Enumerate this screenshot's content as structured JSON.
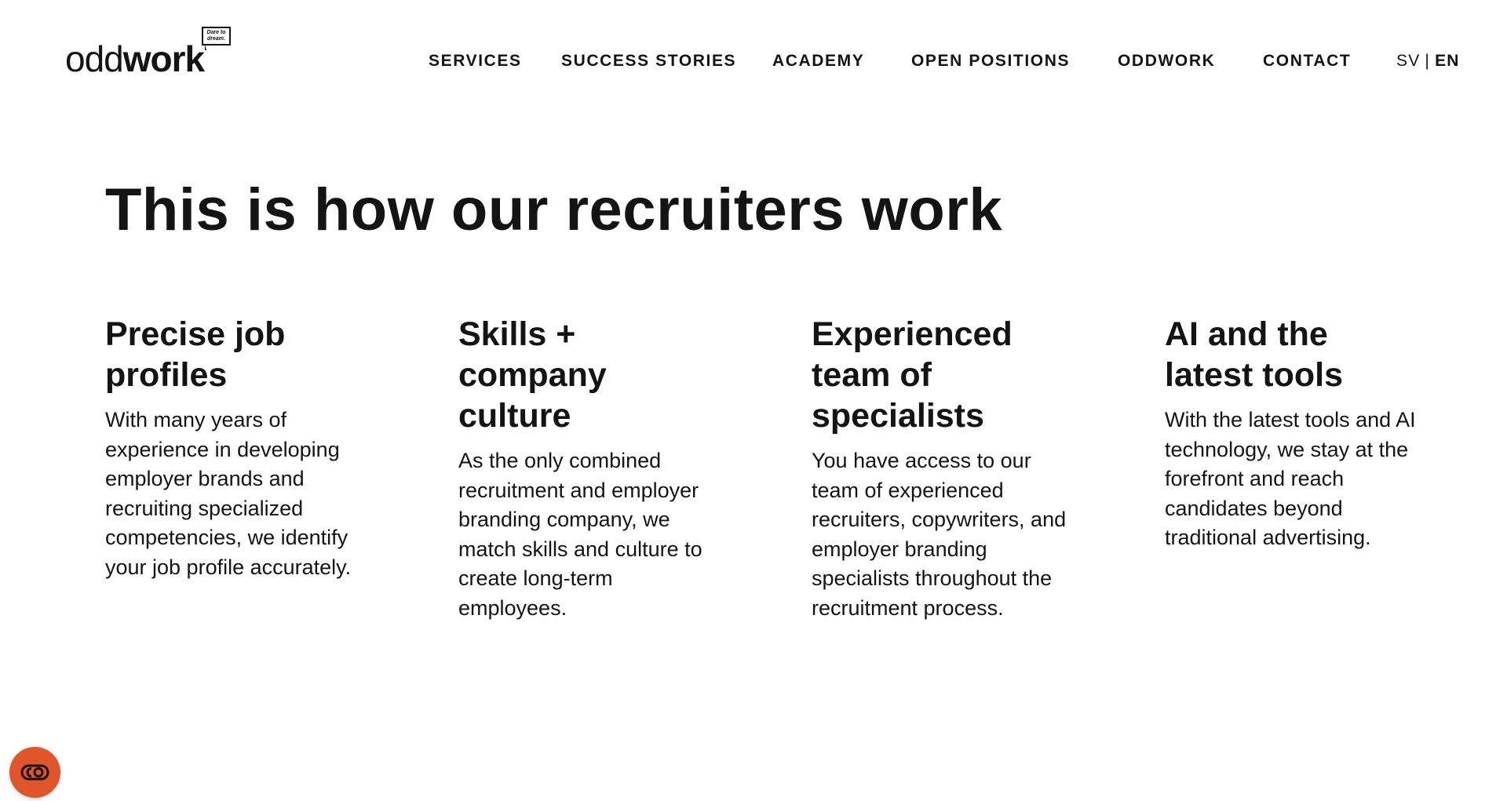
{
  "colors": {
    "accent": "#e0562a",
    "text": "#141414",
    "background": "#ffffff"
  },
  "logo": {
    "light_part": "odd",
    "bold_part": "work",
    "bubble_line1": "Dare to",
    "bubble_line2": "dream."
  },
  "nav": {
    "items": [
      {
        "label": "SERVICES",
        "active": true
      },
      {
        "label": "SUCCESS STORIES",
        "active": false
      },
      {
        "label": "ACADEMY",
        "active": false
      },
      {
        "label": "OPEN POSITIONS",
        "active": false
      },
      {
        "label": "ODDWORK",
        "active": false
      },
      {
        "label": "CONTACT",
        "active": false
      }
    ]
  },
  "language": {
    "sv": "SV",
    "separator": "|",
    "en": "EN",
    "selected": "EN"
  },
  "main": {
    "title": "This is how our recruiters work",
    "features": [
      {
        "title": "Precise job profiles",
        "text": "With many years of experience in developing employer brands and recruiting specialized competencies, we identify your job profile accurately."
      },
      {
        "title": "Skills + company culture",
        "text": "As the only combined recruitment and employer branding company, we match skills and culture to create long-term employees."
      },
      {
        "title": "Experienced team of specialists",
        "text": "You have access to our team of experienced recruiters, copywriters, and employer branding specialists throughout the recruitment process."
      },
      {
        "title": "AI and the latest tools",
        "text": "With the latest tools and AI technology, we stay at the forefront and reach candidates beyond traditional advertising."
      }
    ]
  },
  "floating_button": {
    "icon": "cookie-consent-icon"
  }
}
